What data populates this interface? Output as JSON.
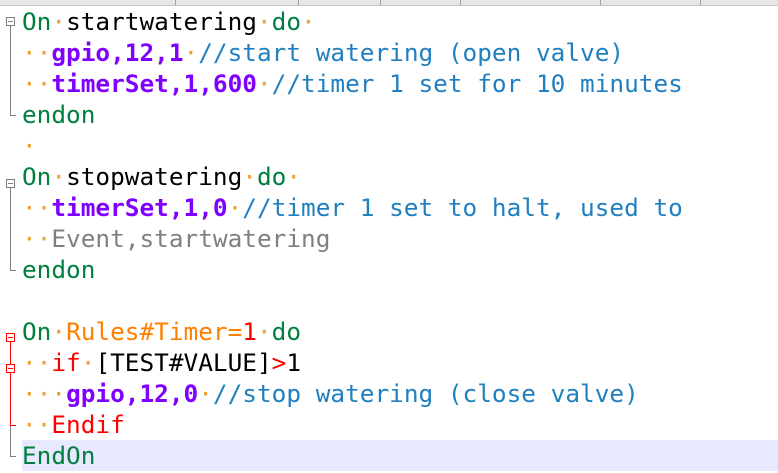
{
  "code": {
    "block1": {
      "on": "On",
      "event": "startwatering",
      "do": "do",
      "cmd1": "gpio,12,1",
      "cmt1": "//start watering (open valve)",
      "cmd2": "timerSet,1,600",
      "cmt2": "//timer 1 set for 10 minutes",
      "endon": "endon"
    },
    "block2": {
      "on": "On",
      "event": "stopwatering",
      "do": "do",
      "cmd1": "timerSet,1,0",
      "cmt1": "//timer 1 set to halt, used to",
      "plain": "Event,startwatering",
      "endon": "endon"
    },
    "block3": {
      "on": "On",
      "event_prefix": "Rules#Timer=",
      "event_num": "1",
      "do": "do",
      "if_kw": "if",
      "cond": "[TEST#VALUE]",
      "op": ">",
      "val": "1",
      "cmd1": "gpio,12,0",
      "cmt1": "//stop watering (close valve)",
      "endif": "Endif",
      "endon": "EndOn"
    }
  },
  "whitespace_dot": "·",
  "colors": {
    "keyword": "#007f3f",
    "command": "#8000ff",
    "comment": "#2080c0",
    "whitespace": "#f0a030",
    "highlight": "#e8e8ff",
    "error_fold": "#ff0000"
  }
}
